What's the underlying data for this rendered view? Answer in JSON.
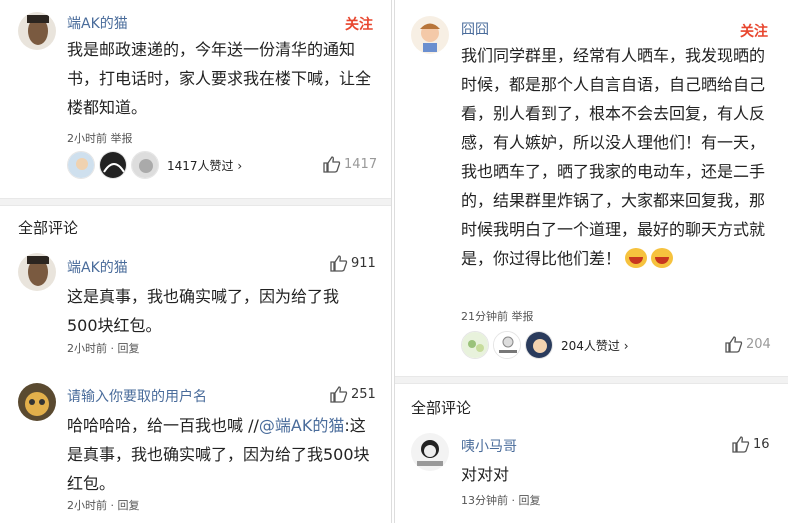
{
  "left": {
    "post": {
      "username": "端AK的猫",
      "follow_label": "关注",
      "text": "我是邮政速递的，今年送一份清华的通知书，打电话时，家人要求我在楼下喊，让全楼都知道。",
      "meta": "2小时前 举报",
      "likes_summary": "1417人赞过 ›",
      "like_count": "1417"
    },
    "section_title": "全部评论",
    "comments": [
      {
        "username": "端AK的猫",
        "like_count": "911",
        "text": "这是真事，我也确实喊了，因为给了我500块红包。",
        "meta": "2小时前 · 回复"
      },
      {
        "username": "请输入你要取的用户名",
        "like_count": "251",
        "text_prefix": "哈哈哈哈，给一百我也喊 //",
        "mention": "@端AK的猫",
        "text_suffix": ":这是真事，我也确实喊了，因为给了我500块红包。",
        "meta": "2小时前 · 回复"
      }
    ]
  },
  "right": {
    "post": {
      "username": "囧囧",
      "follow_label": "关注",
      "text": "我们同学群里，经常有人晒车，我发现晒的时候，都是那个人自言自语，自己晒给自己看，别人看到了，根本不会去回复，有人反感，有人嫉妒，所以没人理他们！有一天，我也晒车了，晒了我家的电动车，还是二手的，结果群里炸锅了，大家都来回复我，那时候我明白了一个道理，最好的聊天方式就是，你过得比他们差！",
      "meta": "21分钟前 举报",
      "likes_summary": "204人赞过 ›",
      "like_count": "204"
    },
    "section_title": "全部评论",
    "comments": [
      {
        "username": "咦小马哥",
        "like_count": "16",
        "text": "对对对",
        "meta": "13分钟前 · 回复"
      }
    ]
  },
  "colors": {
    "username": "#4a6c9b",
    "follow": "#e8462e",
    "divider": "#f2f2f2"
  },
  "icons": [
    "thumbs-up-icon",
    "grin-emoji-icon",
    "avatar"
  ]
}
